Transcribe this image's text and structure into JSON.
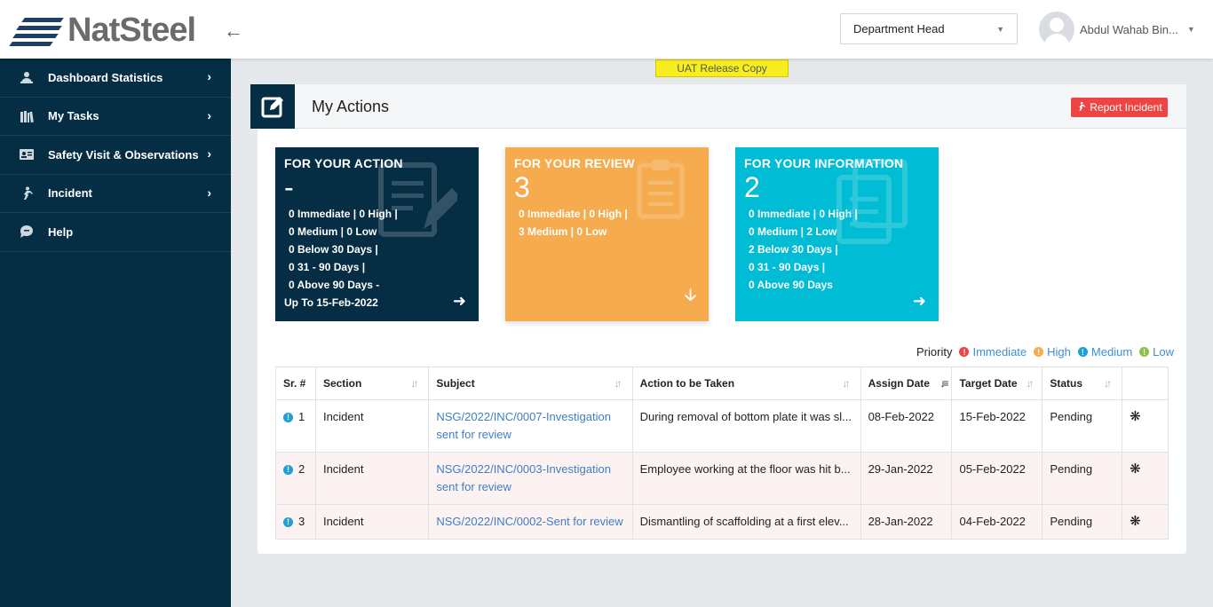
{
  "header": {
    "brand": "NatSteel",
    "role": "Department Head",
    "user_name": "Abdul Wahab Bin..."
  },
  "sidebar": {
    "items": [
      {
        "label": "Dashboard Statistics",
        "icon": "dashboard-user-icon"
      },
      {
        "label": "My Tasks",
        "icon": "books-icon"
      },
      {
        "label": "Safety Visit & Observations",
        "icon": "id-card-icon"
      },
      {
        "label": "Incident",
        "icon": "person-falling-icon"
      },
      {
        "label": "Help",
        "icon": "chat-bubble-icon"
      }
    ]
  },
  "banner": "UAT Release Copy",
  "panel": {
    "title": "My Actions",
    "report_label": "Report Incident"
  },
  "cards": {
    "action": {
      "title": "FOR YOUR ACTION",
      "count": "-",
      "lines": [
        "0  Immediate | 0 High |",
        "0 Medium | 0 Low",
        "0 Below 30 Days |",
        "0 31 - 90 Days |",
        "0 Above 90 Days  -"
      ],
      "footer": "Up To 15-Feb-2022",
      "color": "#052d44"
    },
    "review": {
      "title": "FOR YOUR REVIEW",
      "count": "3",
      "lines": [
        "0  Immediate | 0 High |",
        "3 Medium | 0 Low"
      ],
      "color": "#f5ab4e"
    },
    "information": {
      "title": "FOR YOUR INFORMATION",
      "count": "2",
      "lines": [
        "0  Immediate |  0 High |",
        "0 Medium | 2 Low",
        "2 Below 30 Days |",
        "0 31 - 90 Days |",
        "0 Above 90 Days"
      ],
      "color": "#00bcd4"
    }
  },
  "legend": {
    "label": "Priority",
    "items": [
      {
        "label": "Immediate",
        "color": "#ef4444"
      },
      {
        "label": "High",
        "color": "#f5ab4e"
      },
      {
        "label": "Medium",
        "color": "#1e9fd6"
      },
      {
        "label": "Low",
        "color": "#8bc34a"
      }
    ]
  },
  "table": {
    "columns": [
      "Sr. #",
      "Section",
      "Subject",
      "Action to be Taken",
      "Assign Date",
      "Target Date",
      "Status",
      ""
    ],
    "rows": [
      {
        "sr": "1",
        "section": "Incident",
        "subject": "NSG/2022/INC/0007-Investigation sent for review",
        "action": "During removal of bottom plate it was sl...",
        "assign": "08-Feb-2022",
        "target": "15-Feb-2022",
        "status": "Pending"
      },
      {
        "sr": "2",
        "section": "Incident",
        "subject": "NSG/2022/INC/0003-Investigation sent for review",
        "action": "Employee working at the floor was hit b...",
        "assign": "29-Jan-2022",
        "target": "05-Feb-2022",
        "status": "Pending"
      },
      {
        "sr": "3",
        "section": "Incident",
        "subject": "NSG/2022/INC/0002-Sent for review",
        "action": "Dismantling of scaffolding at a first elev...",
        "assign": "28-Jan-2022",
        "target": "04-Feb-2022",
        "status": "Pending"
      }
    ]
  }
}
